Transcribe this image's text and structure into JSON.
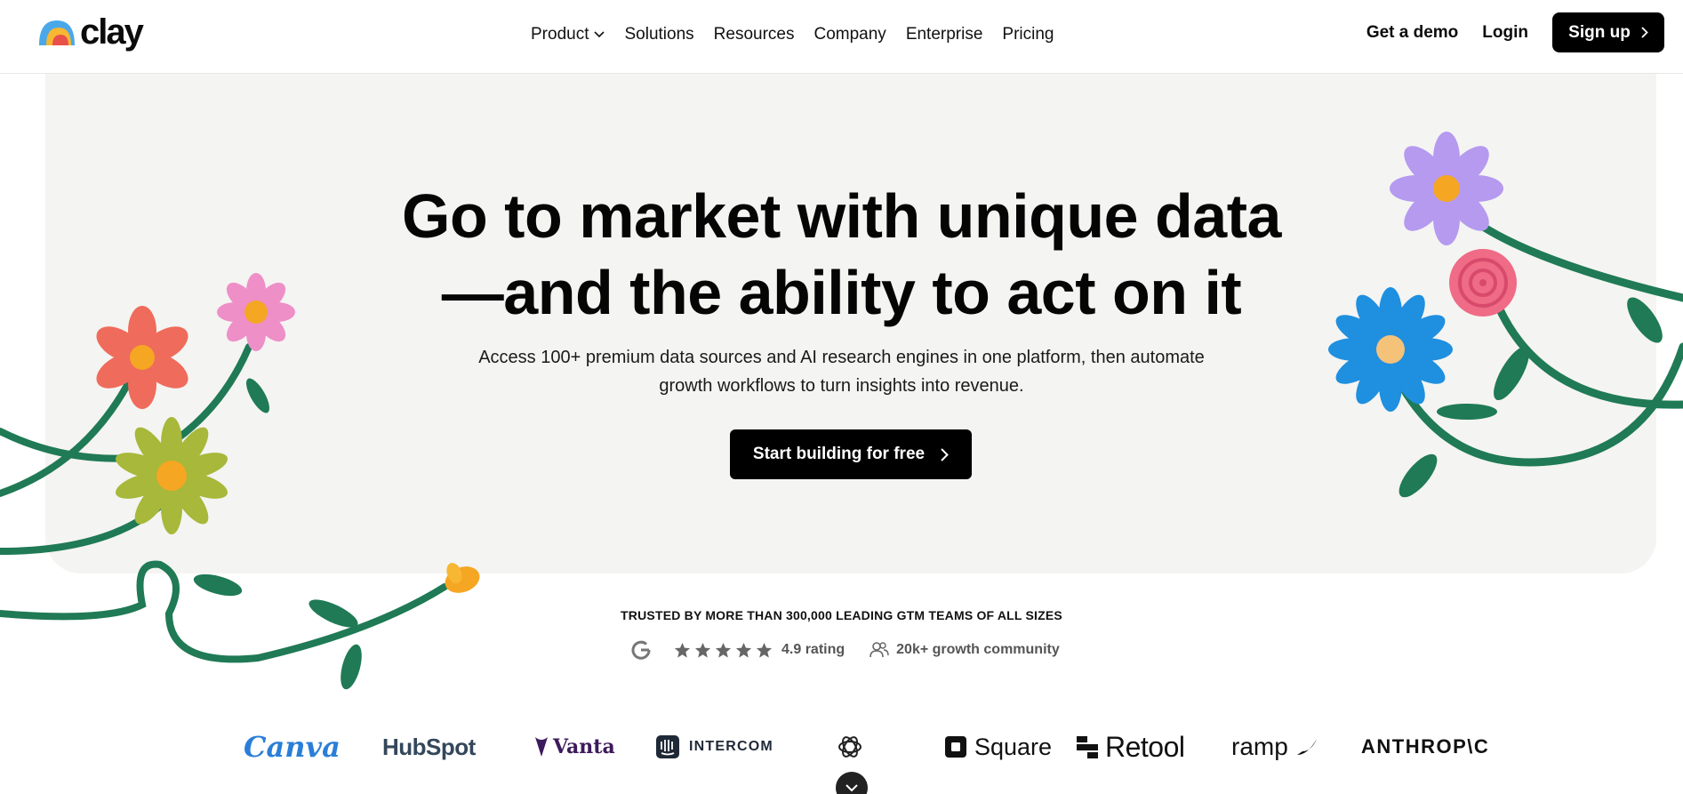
{
  "nav": {
    "brand": "clay",
    "links": [
      {
        "label": "Product",
        "has_dropdown": true
      },
      {
        "label": "Solutions"
      },
      {
        "label": "Resources"
      },
      {
        "label": "Company"
      },
      {
        "label": "Enterprise"
      },
      {
        "label": "Pricing"
      }
    ],
    "demo_label": "Get a demo",
    "login_label": "Login",
    "signup_label": "Sign up"
  },
  "hero": {
    "headline_line1": "Go to market with unique data",
    "headline_line2": "—and the ability to act on it",
    "subtext_line1": "Access 100+ premium data sources and AI research engines in one platform, then automate",
    "subtext_line2": "growth workflows to turn insights into revenue.",
    "cta_label": "Start building for free"
  },
  "trust": {
    "trusted_text": "TRUSTED BY MORE THAN 300,000 LEADING GTM TEAMS OF ALL SIZES",
    "rating_label": "4.9 rating",
    "community_label": "20k+ growth community",
    "stars": 5
  },
  "customer_logos": {
    "canva": "Canva",
    "hubspot": "HubSpot",
    "vanta": "Vanta",
    "intercom": "INTERCOM",
    "square": "Square",
    "retool": "Retool",
    "ramp": "ramp",
    "anthropic": "ANTHROP\\C"
  },
  "colors": {
    "hero_bg": "#f4f4f2",
    "stem_green": "#1f7a55",
    "button_black": "#000000"
  }
}
